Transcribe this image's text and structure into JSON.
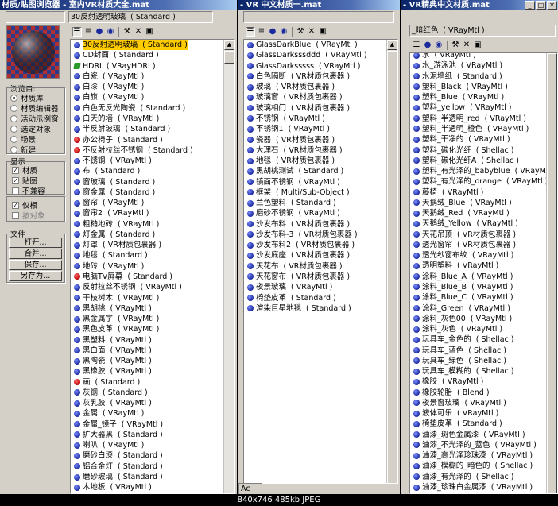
{
  "window1": {
    "title": "材质/贴图浏览器 - 室内VR材质大全.mat",
    "name_field": "30反射透明玻璃  ( Standard )",
    "browse_from": {
      "label": "浏览自:",
      "options": [
        "材质库",
        "材质编辑器",
        "活动示例窗",
        "选定对象",
        "场景",
        "新建"
      ],
      "selected": 0
    },
    "show": {
      "label": "显示",
      "options": [
        {
          "label": "材质",
          "checked": true
        },
        {
          "label": "贴图",
          "checked": true
        },
        {
          "label": "不兼容",
          "checked": false
        }
      ]
    },
    "options2": [
      {
        "label": "仅根",
        "checked": true,
        "disabled": false
      },
      {
        "label": "按对象",
        "checked": false,
        "disabled": true
      }
    ],
    "file": {
      "label": "文件",
      "buttons": [
        "打开...",
        "合并...",
        "保存...",
        "另存为..."
      ]
    },
    "items": [
      {
        "text": "30反射透明玻璃  ( Standard )",
        "icon": "blue",
        "selected": true
      },
      {
        "text": "CD封面  ( Standard )",
        "icon": "blue"
      },
      {
        "text": "HDRI  ( VRayHDRI )",
        "icon": "green"
      },
      {
        "text": "白瓷  ( VRayMtl )",
        "icon": "blue"
      },
      {
        "text": "白漆  ( VRayMtl )",
        "icon": "blue"
      },
      {
        "text": "白旗  ( VRayMtl )",
        "icon": "blue"
      },
      {
        "text": "白色无反光陶瓷  ( Standard )",
        "icon": "blue"
      },
      {
        "text": "白天的墙  ( VRayMtl )",
        "icon": "blue"
      },
      {
        "text": "半反射玻璃  ( Standard )",
        "icon": "blue"
      },
      {
        "text": "办公椅子  ( Standard )",
        "icon": "red"
      },
      {
        "text": "不反射拉丝不锈钢  ( Standard )",
        "icon": "red"
      },
      {
        "text": "不锈钢  ( VRayMtl )",
        "icon": "blue"
      },
      {
        "text": "布  ( Standard )",
        "icon": "blue"
      },
      {
        "text": "窗玻璃  ( Standard )",
        "icon": "blue"
      },
      {
        "text": "窗金属  ( Standard )",
        "icon": "blue"
      },
      {
        "text": "窗帘  ( VRayMtl )",
        "icon": "blue"
      },
      {
        "text": "窗帘2  ( VRayMtl )",
        "icon": "blue"
      },
      {
        "text": "粗糙地砖  ( VRayMtl )",
        "icon": "blue"
      },
      {
        "text": "灯金属  ( Standard )",
        "icon": "blue"
      },
      {
        "text": "灯罩  ( VR材质包裹器 )",
        "icon": "blue"
      },
      {
        "text": "地毯  ( Standard )",
        "icon": "blue"
      },
      {
        "text": "地砖  ( VRayMtl )",
        "icon": "blue"
      },
      {
        "text": "电脑TV屏幕  ( Standard )",
        "icon": "red"
      },
      {
        "text": "反射拉丝不锈钢  ( VRayMtl )",
        "icon": "blue"
      },
      {
        "text": "干枝树木  ( VRayMtl )",
        "icon": "blue"
      },
      {
        "text": "黑胡桃  ( VRayMtl )",
        "icon": "blue"
      },
      {
        "text": "黑金属字  ( VRayMtl )",
        "icon": "blue"
      },
      {
        "text": "黑色皮革  ( VRayMtl )",
        "icon": "blue"
      },
      {
        "text": "黑塑料  ( VRayMtl )",
        "icon": "blue"
      },
      {
        "text": "黑白面  ( VRayMtl )",
        "icon": "blue"
      },
      {
        "text": "黑陶瓷  ( VRayMtl )",
        "icon": "blue"
      },
      {
        "text": "黑橡胶  ( VRayMtl )",
        "icon": "blue"
      },
      {
        "text": "画  ( Standard )",
        "icon": "red"
      },
      {
        "text": "灰钢  ( Standard )",
        "icon": "blue"
      },
      {
        "text": "灰乳胶  ( VRayMtl )",
        "icon": "blue"
      },
      {
        "text": "金属  ( VRayMtl )",
        "icon": "blue"
      },
      {
        "text": "金属_镜子  ( VRayMtl )",
        "icon": "blue"
      },
      {
        "text": "扩大器黑  ( Standard )",
        "icon": "blue"
      },
      {
        "text": "喇叭  ( VRayMtl )",
        "icon": "blue"
      },
      {
        "text": "磨砂白漆  ( Standard )",
        "icon": "blue"
      },
      {
        "text": "铝合金灯  ( Standard )",
        "icon": "blue"
      },
      {
        "text": "磨砂玻璃  ( Standard )",
        "icon": "blue"
      },
      {
        "text": "木地板  ( VRayMtl )",
        "icon": "blue"
      }
    ]
  },
  "window2": {
    "title": "- VR 中文材质一.mat",
    "items": [
      {
        "text": "GlassDarkBlue  ( VRayMtl )",
        "icon": "blue"
      },
      {
        "text": "GlassDarksssddd  ( VRayMtl )",
        "icon": "blue"
      },
      {
        "text": "GlassDarksssss  ( VRayMtl )",
        "icon": "blue"
      },
      {
        "text": "白色隔断  ( VR材质包裹器 )",
        "icon": "blue"
      },
      {
        "text": "玻璃  ( VR材质包裹器 )",
        "icon": "blue"
      },
      {
        "text": "玻璃窗  ( VR材质包裹器 )",
        "icon": "blue"
      },
      {
        "text": "玻璃相门  ( VR材质包裹器 )",
        "icon": "blue"
      },
      {
        "text": "不锈钢  ( VRayMtl )",
        "icon": "blue"
      },
      {
        "text": "不锈钢1  ( VRayMtl )",
        "icon": "blue"
      },
      {
        "text": "瓷器  ( VR材质包裹器 )",
        "icon": "blue"
      },
      {
        "text": "大理石  ( VR材质包裹器 )",
        "icon": "blue"
      },
      {
        "text": "地毯  ( VR材质包裹器 )",
        "icon": "blue"
      },
      {
        "text": "黑胡桃测试  ( Standard )",
        "icon": "blue"
      },
      {
        "text": "镜面不锈钢  ( VRayMtl )",
        "icon": "blue"
      },
      {
        "text": "框架  ( Multi/Sub-Object )",
        "icon": "blue"
      },
      {
        "text": "兰色塑料  ( Standard )",
        "icon": "blue"
      },
      {
        "text": "磨砂不锈钢  ( VRayMtl )",
        "icon": "blue"
      },
      {
        "text": "沙发布料  ( VR材质包裹器 )",
        "icon": "blue"
      },
      {
        "text": "沙发布料-3  ( VR材质包裹器 )",
        "icon": "blue"
      },
      {
        "text": "沙发布料2  ( VR材质包裹器 )",
        "icon": "blue"
      },
      {
        "text": "沙发底座  ( VR材质包裹器 )",
        "icon": "blue"
      },
      {
        "text": "天花布  ( VR材质包裹器 )",
        "icon": "blue"
      },
      {
        "text": "天花窗布  ( VR材质包裹器 )",
        "icon": "blue"
      },
      {
        "text": "夜景玻璃  ( VRayMtl )",
        "icon": "blue"
      },
      {
        "text": "椅垫皮革  ( Standard )",
        "icon": "blue"
      },
      {
        "text": "渲染巨星地毯  ( Standard )",
        "icon": "blue"
      }
    ],
    "bottom_text": "Ac"
  },
  "window3": {
    "title": "- VR精典中文材质.mat",
    "name_field": "_暗红色  ( VRayMtl )",
    "items": [
      {
        "text": "水  ( VRayMtl )",
        "icon": "blue"
      },
      {
        "text": "水_游泳池  ( VRayMtl )",
        "icon": "blue"
      },
      {
        "text": "水泥墙纸  ( Standard )",
        "icon": "blue"
      },
      {
        "text": "塑料_Black  ( VRayMtl )",
        "icon": "blue"
      },
      {
        "text": "塑料_Blue  ( VRayMtl )",
        "icon": "blue"
      },
      {
        "text": "塑料_yellow  ( VRayMtl )",
        "icon": "blue"
      },
      {
        "text": "塑料_半透明_red  ( VRayMtl )",
        "icon": "blue"
      },
      {
        "text": "塑料_半透明_橙色  ( VRayMtl )",
        "icon": "blue"
      },
      {
        "text": "塑料_干净的  ( VRayMtl )",
        "icon": "blue"
      },
      {
        "text": "塑料_碳化光纤  ( Shellac )",
        "icon": "blue"
      },
      {
        "text": "塑料_碳化光纤A  ( Shellac )",
        "icon": "blue"
      },
      {
        "text": "塑料_有光泽的_babyblue  ( VRayMtl )",
        "icon": "blue"
      },
      {
        "text": "塑料_有光泽的_orange  ( VRayMtl )",
        "icon": "blue"
      },
      {
        "text": "藤椅  ( VRayMtl )",
        "icon": "blue"
      },
      {
        "text": "天鹅绒_Blue  ( VRayMtl )",
        "icon": "blue"
      },
      {
        "text": "天鹅绒_Red  ( VRayMtl )",
        "icon": "blue"
      },
      {
        "text": "天鹅绒_Yellow  ( VRayMtl )",
        "icon": "blue"
      },
      {
        "text": "天花吊顶  ( VR材质包裹器 )",
        "icon": "blue"
      },
      {
        "text": "透光窗帘  ( VR材质包裹器 )",
        "icon": "blue"
      },
      {
        "text": "透光纱窗布纹  ( VRayMtl )",
        "icon": "blue"
      },
      {
        "text": "透明塑料  ( VRayMtl )",
        "icon": "blue"
      },
      {
        "text": "涂料_Blue_A  ( VRayMtl )",
        "icon": "blue"
      },
      {
        "text": "涂料_Blue_B  ( VRayMtl )",
        "icon": "blue"
      },
      {
        "text": "涂料_Blue_C  ( VRayMtl )",
        "icon": "blue"
      },
      {
        "text": "涂料_Green  ( VRayMtl )",
        "icon": "blue"
      },
      {
        "text": "涂料_灰色00  ( VRayMtl )",
        "icon": "blue"
      },
      {
        "text": "涂料_灰色  ( VRayMtl )",
        "icon": "blue"
      },
      {
        "text": "玩具车_金色的  ( Shellac )",
        "icon": "blue"
      },
      {
        "text": "玩具车_蓝色  ( Shellac )",
        "icon": "blue"
      },
      {
        "text": "玩具车_绿色  ( Shellac )",
        "icon": "blue"
      },
      {
        "text": "玩具车_模糊的  ( Shellac )",
        "icon": "blue"
      },
      {
        "text": "橡胶  ( VRayMtl )",
        "icon": "blue"
      },
      {
        "text": "橡胶轮胎  ( Blend )",
        "icon": "blue"
      },
      {
        "text": "夜景窗玻璃  ( VRayMtl )",
        "icon": "blue"
      },
      {
        "text": "液体可乐  ( VRayMtl )",
        "icon": "blue"
      },
      {
        "text": "椅垫皮革  ( Standard )",
        "icon": "blue"
      },
      {
        "text": "油漆_斑色金属漆  ( VRayMtl )",
        "icon": "blue"
      },
      {
        "text": "油漆_不光泽的_蓝色  ( VRayMtl )",
        "icon": "blue"
      },
      {
        "text": "油漆_高光泽珍珠漆  ( VRayMtl )",
        "icon": "blue"
      },
      {
        "text": "油漆_模糊的_暗色的  ( Shellac )",
        "icon": "blue"
      },
      {
        "text": "油漆_有光泽的  ( Shellac )",
        "icon": "blue"
      },
      {
        "text": "油漆_珍珠白金属漆  ( VRayMtl )",
        "icon": "blue"
      }
    ]
  },
  "footer": "840x746  485kb  JPEG"
}
